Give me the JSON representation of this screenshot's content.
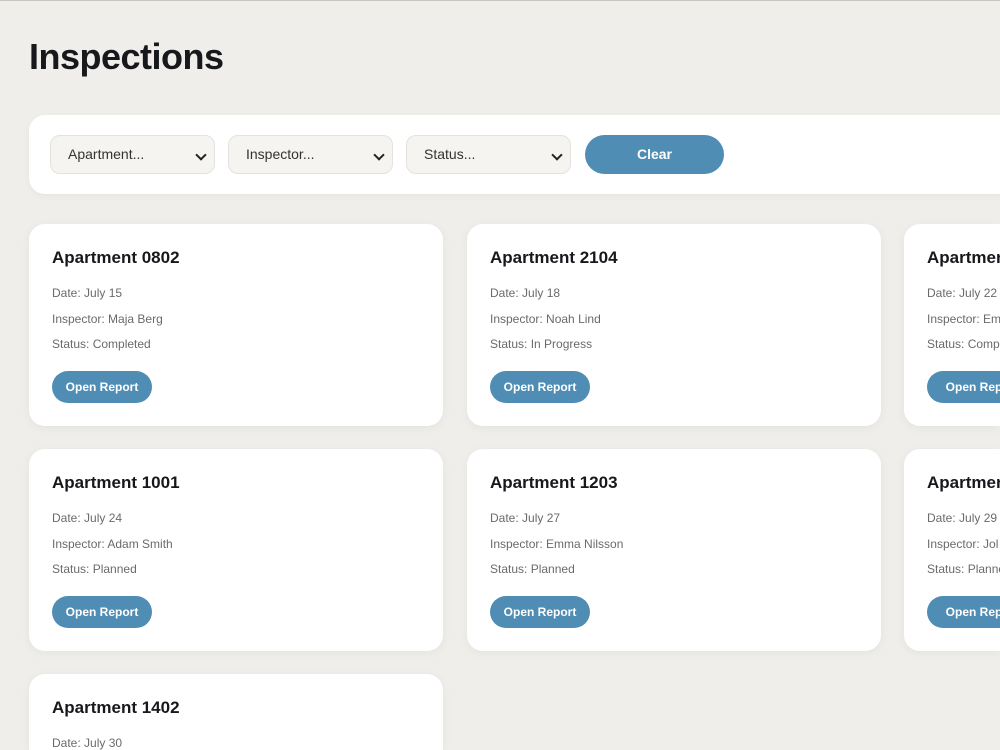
{
  "page": {
    "title": "Inspections"
  },
  "filters": {
    "apartment_placeholder": "Apartment...",
    "inspector_placeholder": "Inspector...",
    "status_placeholder": "Status...",
    "clear_label": "Clear"
  },
  "labels": {
    "date": "Date:",
    "inspector": "Inspector:",
    "status": "Status:",
    "open_report": "Open Report"
  },
  "cards": [
    {
      "title": "Apartment 0802",
      "date": "July 15",
      "inspector": "Maja Berg",
      "status": "Completed"
    },
    {
      "title": "Apartment 2104",
      "date": "July 18",
      "inspector": "Noah Lind",
      "status": "In Progress"
    },
    {
      "title": "Apartmen",
      "date": "July 22",
      "inspector": "Em",
      "status": "Comp"
    },
    {
      "title": "Apartment 1001",
      "date": "July 24",
      "inspector": "Adam Smith",
      "status": "Planned"
    },
    {
      "title": "Apartment 1203",
      "date": "July 27",
      "inspector": "Emma Nilsson",
      "status": "Planned"
    },
    {
      "title": "Apartmen",
      "date": "July 29",
      "inspector": "Jol",
      "status": "Planne"
    },
    {
      "title": "Apartment 1402",
      "date": "July 30"
    }
  ],
  "colors": {
    "background": "#f0eeea",
    "accent": "#4f8db5",
    "card": "#ffffff"
  }
}
